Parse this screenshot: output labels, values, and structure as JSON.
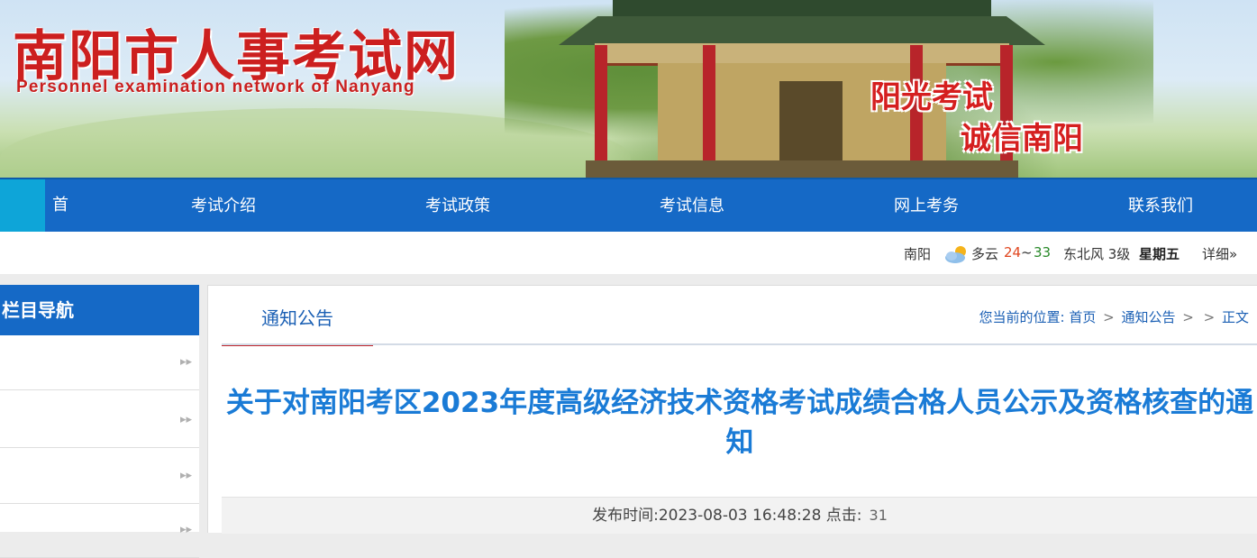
{
  "banner": {
    "site_title": "南阳市人事考试网",
    "site_title_en": "Personnel examination network of Nanyang",
    "slogan_line1": "阳光考试",
    "slogan_line2": "诚信南阳"
  },
  "nav": {
    "home": "首页",
    "items": [
      "考试介绍",
      "考试政策",
      "考试信息",
      "网上考务",
      "联系我们"
    ]
  },
  "weather": {
    "city": "南阳",
    "icon": "partly-cloudy-icon",
    "condition": "多云",
    "temp_low": "24",
    "sep": "~",
    "temp_high": "33",
    "wind": "东北风 3级",
    "weekday": "星期五",
    "detail": "详细»"
  },
  "sidebar": {
    "heading": "栏目导航",
    "items": [
      "",
      "",
      "",
      ""
    ]
  },
  "main": {
    "tab_label": "通知公告",
    "breadcrumb": {
      "prefix": "您当前的位置:",
      "home": "首页",
      "section": "通知公告",
      "current": "正文",
      "sep": ">"
    },
    "article_title": "关于对南阳考区2023年度高级经济技术资格考试成绩合格人员公示及资格核查的通知",
    "publish_label": "发布时间:",
    "publish_time": "2023-08-03 16:48:28",
    "clicks_label": "点击:",
    "clicks": "31"
  },
  "colors": {
    "nav_blue": "#1569c6",
    "home_cyan": "#0ea5d8",
    "title_red": "#cc1f1f",
    "article_title_blue": "#1a7bd6",
    "tab_underline_red": "#c0272d",
    "temp_low": "#e0461f",
    "temp_high": "#2a8a2a"
  }
}
